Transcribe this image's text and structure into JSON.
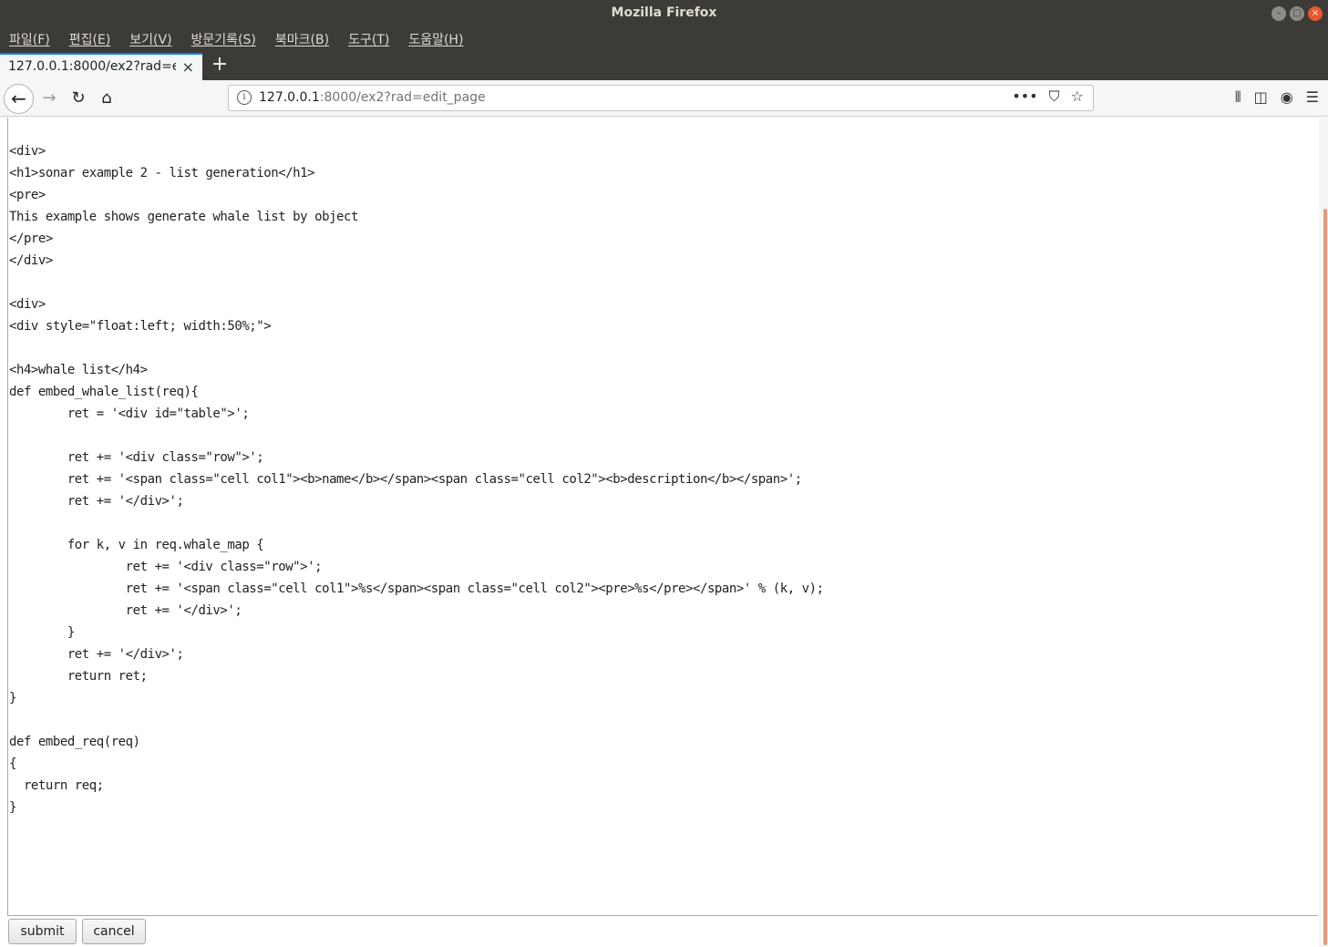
{
  "window": {
    "title": "Mozilla Firefox",
    "controls": [
      "–",
      "□",
      "×"
    ]
  },
  "menu": [
    "파일(F)",
    "편집(E)",
    "보기(V)",
    "방문기록(S)",
    "북마크(B)",
    "도구(T)",
    "도움말(H)"
  ],
  "tab": {
    "label": "127.0.0.1:8000/ex2?rad=edit_page",
    "close": "×",
    "new_tab": "+"
  },
  "nav": {
    "back": "←",
    "forward": "→",
    "reload": "↻",
    "home": "⌂",
    "info": "i",
    "url_host": "127.0.0.1",
    "url_rest": ":8000/ex2?rad=edit_page",
    "more": "•••",
    "pocket": "⛉",
    "bookmark": "☆",
    "library": "⫴",
    "sidebar": "◫",
    "account": "◉",
    "menu": "☰"
  },
  "editor": {
    "text": "\n<div>\n<h1>sonar example 2 - list generation</h1>\n<pre>\nThis example shows generate whale list by object\n</pre>\n</div>\n\n<div>\n<div style=\"float:left; width:50%;\">\n\n<h4>whale list</h4>\ndef embed_whale_list(req){\n        ret = '<div id=\"table\">';\n\n        ret += '<div class=\"row\">';\n        ret += '<span class=\"cell col1\"><b>name</b></span><span class=\"cell col2\"><b>description</b></span>';\n        ret += '</div>';\n\n        for k, v in req.whale_map {\n                ret += '<div class=\"row\">';\n                ret += '<span class=\"cell col1\">%s</span><span class=\"cell col2\"><pre>%s</pre></span>' % (k, v);\n                ret += '</div>';\n        }\n        ret += '</div>';\n        return ret;\n}\n\ndef embed_req(req)\n{\n  return req;\n}\n\n\n\n\n\n<hr> <hr> <hr> <a href=\"/\">back to main</a>"
  },
  "buttons": {
    "submit": "submit",
    "cancel": "cancel"
  }
}
